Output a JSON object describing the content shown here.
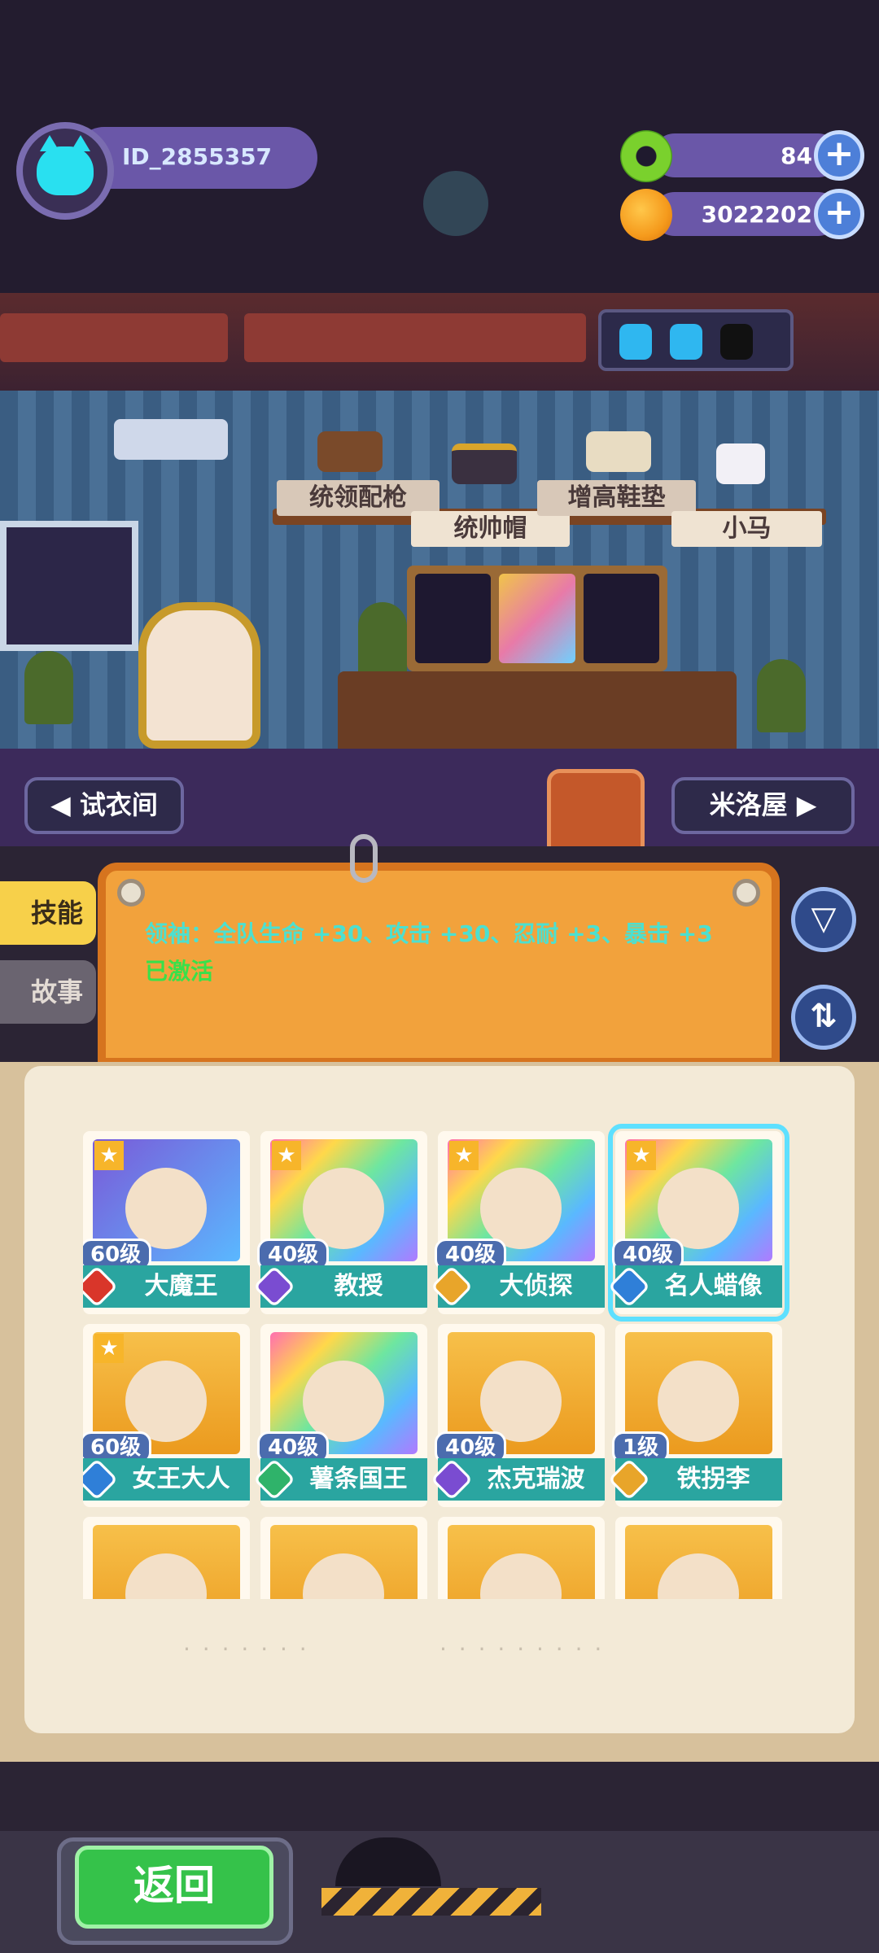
{
  "player": {
    "id": "ID_2855357",
    "avatar_icon": "cat-face-icon"
  },
  "resources": {
    "gems": {
      "value": "84",
      "icon": "green-donut-gem-icon"
    },
    "coins": {
      "value": "3022202",
      "icon": "planet-coin-icon"
    }
  },
  "energy": {
    "total": 3,
    "filled": 2
  },
  "equipment": [
    {
      "label": "统领配枪",
      "icon": "pistol-icon"
    },
    {
      "label": "统帅帽",
      "icon": "bicorne-hat-icon"
    },
    {
      "label": "增高鞋垫",
      "icon": "insole-icon"
    },
    {
      "label": "小马",
      "icon": "pony-icon"
    }
  ],
  "nav": {
    "left": "试衣间",
    "right": "米洛屋"
  },
  "tabs": {
    "skill": "技能",
    "story": "故事"
  },
  "skill_panel": {
    "text": "领袖：全队生命 +30、攻击 +30、忍耐 +3、暴击 +3",
    "status": "已激活"
  },
  "characters": [
    {
      "name": "大魔王",
      "level": "60级",
      "bg": "purple",
      "shield": "#d9362a",
      "star": true
    },
    {
      "name": "教授",
      "level": "40级",
      "bg": "rainbow",
      "shield": "#7a4cd1",
      "star": true
    },
    {
      "name": "大侦探",
      "level": "40级",
      "bg": "rainbow",
      "shield": "#e8a52a",
      "star": true
    },
    {
      "name": "名人蜡像",
      "level": "40级",
      "bg": "rainbow",
      "shield": "#2f7fd8",
      "star": true,
      "selected": true
    },
    {
      "name": "女王大人",
      "level": "60级",
      "bg": "gold",
      "shield": "#2f7fd8",
      "star": true
    },
    {
      "name": "薯条国王",
      "level": "40级",
      "bg": "rainbow",
      "shield": "#2fb36a",
      "star": false
    },
    {
      "name": "杰克瑞波",
      "level": "40级",
      "bg": "gold",
      "shield": "#7a4cd1",
      "star": false
    },
    {
      "name": "铁拐李",
      "level": "1级",
      "bg": "gold",
      "shield": "#e8a52a",
      "star": false
    },
    {
      "name": "",
      "level": "",
      "bg": "gold",
      "shield": "",
      "star": false
    },
    {
      "name": "",
      "level": "",
      "bg": "gold",
      "shield": "",
      "star": false
    },
    {
      "name": "",
      "level": "",
      "bg": "gold",
      "shield": "",
      "star": false
    },
    {
      "name": "",
      "level": "",
      "bg": "gold",
      "shield": "",
      "star": false
    }
  ],
  "back_button": "返回"
}
